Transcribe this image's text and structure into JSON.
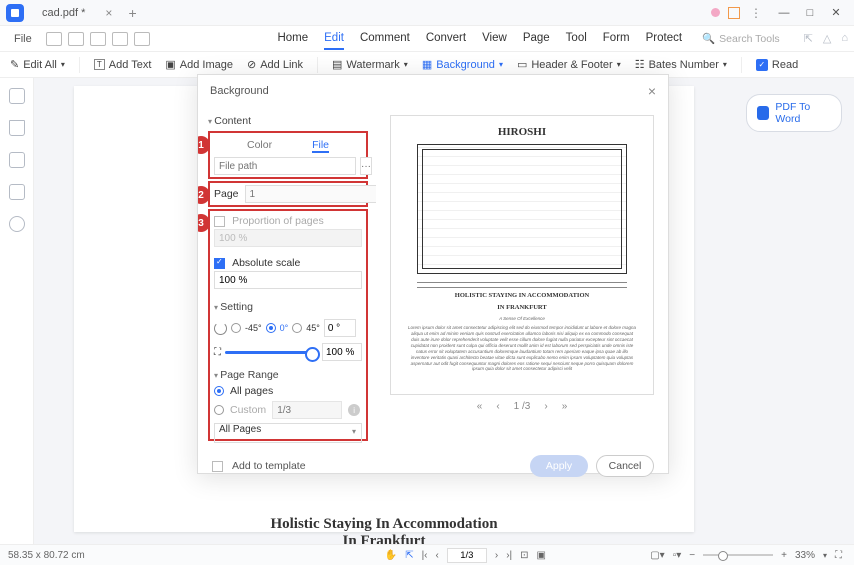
{
  "titlebar": {
    "tab_name": "cad.pdf *"
  },
  "menubar": {
    "file": "File",
    "tabs": [
      "Home",
      "Edit",
      "Comment",
      "Convert",
      "View",
      "Page",
      "Tool",
      "Form",
      "Protect"
    ],
    "active_tab": "Edit",
    "search_placeholder": "Search Tools"
  },
  "toolbar": {
    "edit_all": "Edit All",
    "add_text": "Add Text",
    "add_image": "Add Image",
    "add_link": "Add Link",
    "watermark": "Watermark",
    "background": "Background",
    "header_footer": "Header & Footer",
    "bates_number": "Bates Number",
    "read": "Read"
  },
  "right_panel": {
    "pdf_to_word": "PDF To Word"
  },
  "doc": {
    "title1": "Holistic Staying In Accommodation",
    "title2": "In Frankfurt"
  },
  "dialog": {
    "title": "Background",
    "content_section": "Content",
    "tab_color": "Color",
    "tab_file": "File",
    "file_path_placeholder": "File path",
    "page_label": "Page",
    "page_value": "1",
    "proportion_label": "Proportion of pages",
    "proportion_value": "100 %",
    "absolute_label": "Absolute scale",
    "absolute_value": "100 %",
    "setting_section": "Setting",
    "deg_n45": "-45°",
    "deg_0": "0°",
    "deg_45": "45°",
    "deg_input": "0 °",
    "scale_value": "100 %",
    "range_section": "Page Range",
    "all_pages": "All pages",
    "custom": "Custom",
    "custom_placeholder": "1/3",
    "select_value": "All Pages",
    "add_template": "Add to template",
    "apply": "Apply",
    "cancel": "Cancel",
    "preview": {
      "title": "HIROSHI",
      "caption1": "HOLISTIC STAYING IN ACCOMMODATION",
      "caption2": "IN FRANKFURT",
      "subcaption": "A Sense Of Excellence",
      "pager": "1 /3"
    },
    "annotations": {
      "n1": "1",
      "n2": "2",
      "n3": "3"
    }
  },
  "statusbar": {
    "dimensions": "58.35 x 80.72 cm",
    "page": "1/3",
    "zoom": "33%"
  }
}
